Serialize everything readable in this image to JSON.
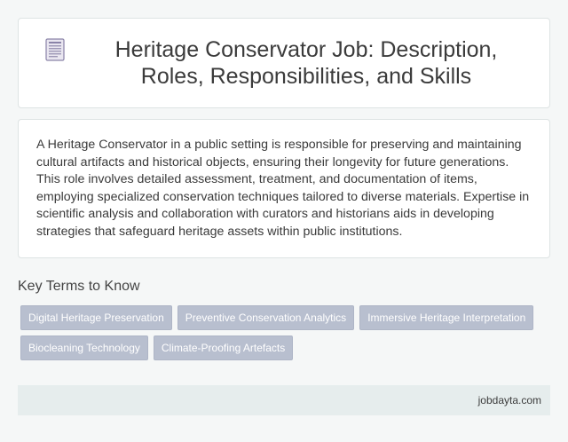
{
  "header": {
    "title": "Heritage Conservator Job: Description, Roles, Responsibilities, and Skills",
    "icon": "document-icon"
  },
  "description": {
    "text": "A Heritage Conservator in a public setting is responsible for preserving and maintaining cultural artifacts and historical objects, ensuring their longevity for future generations. This role involves detailed assessment, treatment, and documentation of items, employing specialized conservation techniques tailored to diverse materials. Expertise in scientific analysis and collaboration with curators and historians aids in developing strategies that safeguard heritage assets within public institutions."
  },
  "key_terms": {
    "heading": "Key Terms to Know",
    "items": [
      "Digital Heritage Preservation",
      "Preventive Conservation Analytics",
      "Immersive Heritage Interpretation",
      "Biocleaning Technology",
      "Climate-Proofing Artefacts"
    ]
  },
  "footer": {
    "site": "jobdayta.com"
  },
  "colors": {
    "background": "#f5f7f7",
    "card": "#ffffff",
    "chip": "#b8bfcf",
    "footer": "#e6eded",
    "icon": "#8a83a8"
  }
}
